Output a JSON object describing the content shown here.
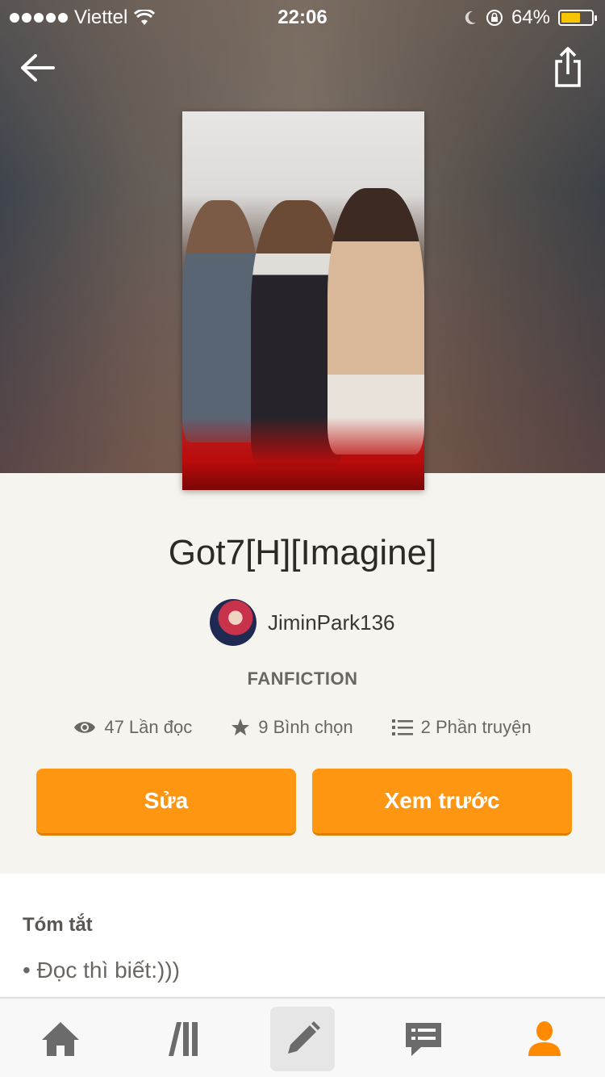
{
  "status_bar": {
    "carrier": "Viettel",
    "time": "22:06",
    "battery": "64%",
    "battery_level": 0.64
  },
  "story": {
    "title": "Got7[H][Imagine]",
    "author": "JiminPark136",
    "category": "FANFICTION"
  },
  "stats": {
    "reads": "47 Lần đọc",
    "votes": "9 Bình chọn",
    "parts": "2 Phần truyện"
  },
  "buttons": {
    "edit": "Sửa",
    "preview": "Xem trước"
  },
  "summary": {
    "heading": "Tóm tắt",
    "text": "• Đọc thì biết:)))"
  },
  "tabbar": {
    "items": [
      "home-icon",
      "library-icon",
      "write-icon",
      "messages-icon",
      "profile-icon"
    ],
    "active": "write-icon"
  },
  "colors": {
    "accent": "#ff9612",
    "active_tab": "#ff8a00",
    "tab_icon": "#6b6b6b"
  }
}
